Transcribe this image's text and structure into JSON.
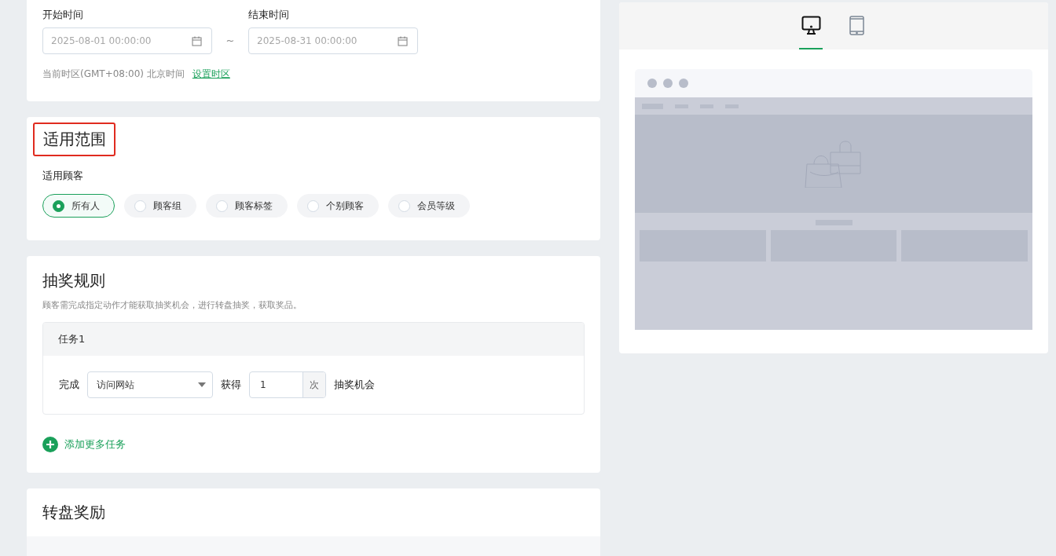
{
  "time_section": {
    "start_label": "开始时间",
    "start_value": "2025-08-01 00:00:00",
    "separator": "~",
    "end_label": "结束时间",
    "end_value": "2025-08-31 00:00:00",
    "timezone_text": "当前时区(GMT+08:00) 北京时间",
    "timezone_link": "设置时区"
  },
  "scope_section": {
    "title": "适用范围",
    "highlighted": true,
    "customer_label": "适用顾客",
    "options": [
      {
        "label": "所有人",
        "selected": true
      },
      {
        "label": "顾客组",
        "selected": false
      },
      {
        "label": "顾客标签",
        "selected": false
      },
      {
        "label": "个别顾客",
        "selected": false
      },
      {
        "label": "会员等级",
        "selected": false
      }
    ]
  },
  "rules_section": {
    "title": "抽奖规则",
    "description": "顾客需完成指定动作才能获取抽奖机会，进行转盘抽奖，获取奖品。",
    "tasks": [
      {
        "title": "任务1",
        "complete_label": "完成",
        "action": "访问网站",
        "get_label": "获得",
        "count": "1",
        "unit": "次",
        "suffix": "抽奖机会"
      }
    ],
    "add_task": "添加更多任务"
  },
  "rewards_section": {
    "title": "转盘奖励"
  },
  "preview": {
    "tabs": [
      {
        "kind": "desktop",
        "selected": true
      },
      {
        "kind": "tablet",
        "selected": false
      }
    ]
  }
}
